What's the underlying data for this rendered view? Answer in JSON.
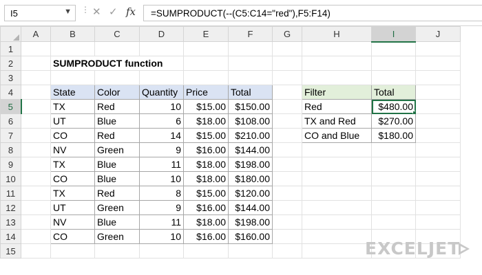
{
  "name_box": "I5",
  "formula": "=SUMPRODUCT(--(C5:C14=\"red\"),F5:F14)",
  "icons": {
    "name_box_dropdown": "chevron-down-icon",
    "cancel": "x-icon",
    "enter": "check-icon",
    "function": "fx-icon"
  },
  "columns": [
    "A",
    "B",
    "C",
    "D",
    "E",
    "F",
    "G",
    "H",
    "I",
    "J"
  ],
  "rows": [
    "1",
    "2",
    "3",
    "4",
    "5",
    "6",
    "7",
    "8",
    "9",
    "10",
    "11",
    "12",
    "13",
    "14",
    "15"
  ],
  "title": "SUMPRODUCT function",
  "data_table": {
    "headers": [
      "State",
      "Color",
      "Quantity",
      "Price",
      "Total"
    ],
    "rows": [
      [
        "TX",
        "Red",
        "10",
        "$15.00",
        "$150.00"
      ],
      [
        "UT",
        "Blue",
        "6",
        "$18.00",
        "$108.00"
      ],
      [
        "CO",
        "Red",
        "14",
        "$15.00",
        "$210.00"
      ],
      [
        "NV",
        "Green",
        "9",
        "$16.00",
        "$144.00"
      ],
      [
        "TX",
        "Blue",
        "11",
        "$18.00",
        "$198.00"
      ],
      [
        "CO",
        "Blue",
        "10",
        "$18.00",
        "$180.00"
      ],
      [
        "TX",
        "Red",
        "8",
        "$15.00",
        "$120.00"
      ],
      [
        "UT",
        "Green",
        "9",
        "$16.00",
        "$144.00"
      ],
      [
        "NV",
        "Blue",
        "11",
        "$18.00",
        "$198.00"
      ],
      [
        "CO",
        "Green",
        "10",
        "$16.00",
        "$160.00"
      ]
    ]
  },
  "summary_table": {
    "headers": [
      "Filter",
      "Total"
    ],
    "rows": [
      [
        "Red",
        "$480.00"
      ],
      [
        "TX and Red",
        "$270.00"
      ],
      [
        "CO and Blue",
        "$180.00"
      ]
    ]
  },
  "logo": "EXCELJET",
  "colors": {
    "header_blue": "#dae3f3",
    "header_green": "#e2efda",
    "selection": "#217346",
    "logo": "#c8c8c8"
  }
}
